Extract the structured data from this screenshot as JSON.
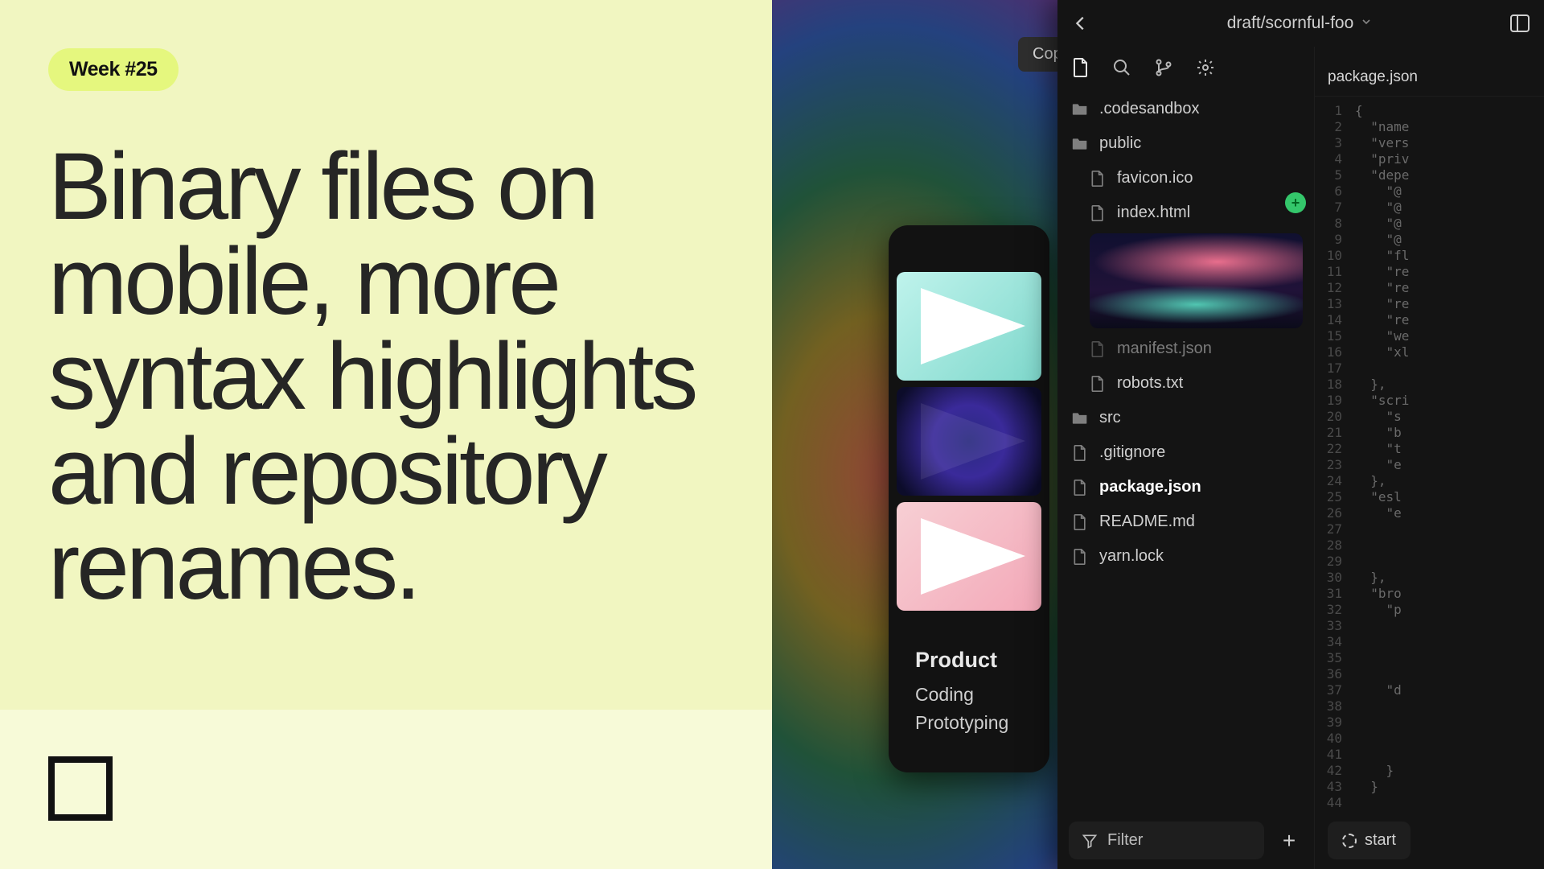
{
  "badge": "Week #25",
  "headline": "Binary files on mobile, more syntax highlights and repository renames.",
  "copy_label": "Copy",
  "product": {
    "title": "Product",
    "items": [
      "Coding",
      "Prototyping"
    ]
  },
  "editor": {
    "branch": "draft/scornful-foo",
    "active_tab": "package.json",
    "filter_placeholder": "Filter",
    "run_label": "start",
    "tree": [
      {
        "name": ".codesandbox",
        "type": "folder",
        "indent": false
      },
      {
        "name": "public",
        "type": "folder",
        "indent": false
      },
      {
        "name": "favicon.ico",
        "type": "file",
        "indent": true
      },
      {
        "name": "index.html",
        "type": "file",
        "indent": true,
        "preview": true
      },
      {
        "name": "manifest.json",
        "type": "file",
        "indent": true,
        "obscured": true
      },
      {
        "name": "robots.txt",
        "type": "file",
        "indent": true
      },
      {
        "name": "src",
        "type": "folder",
        "indent": false
      },
      {
        "name": ".gitignore",
        "type": "file",
        "indent": false
      },
      {
        "name": "package.json",
        "type": "file",
        "indent": false,
        "active": true
      },
      {
        "name": "README.md",
        "type": "file",
        "indent": false
      },
      {
        "name": "yarn.lock",
        "type": "file",
        "indent": false
      }
    ],
    "code_lines": [
      "{",
      "  \"name",
      "  \"vers",
      "  \"priv",
      "  \"depe",
      "    \"@",
      "    \"@",
      "    \"@",
      "    \"@",
      "    \"fl",
      "    \"re",
      "    \"re",
      "    \"re",
      "    \"re",
      "    \"we",
      "    \"xl",
      "",
      "  },",
      "  \"scri",
      "    \"s",
      "    \"b",
      "    \"t",
      "    \"e",
      "  },",
      "  \"esl",
      "    \"e",
      "",
      "",
      "",
      "  },",
      "  \"bro",
      "    \"p",
      "",
      "",
      "",
      "",
      "    \"d",
      "",
      "",
      "",
      "",
      "    }",
      "  }",
      ""
    ]
  }
}
